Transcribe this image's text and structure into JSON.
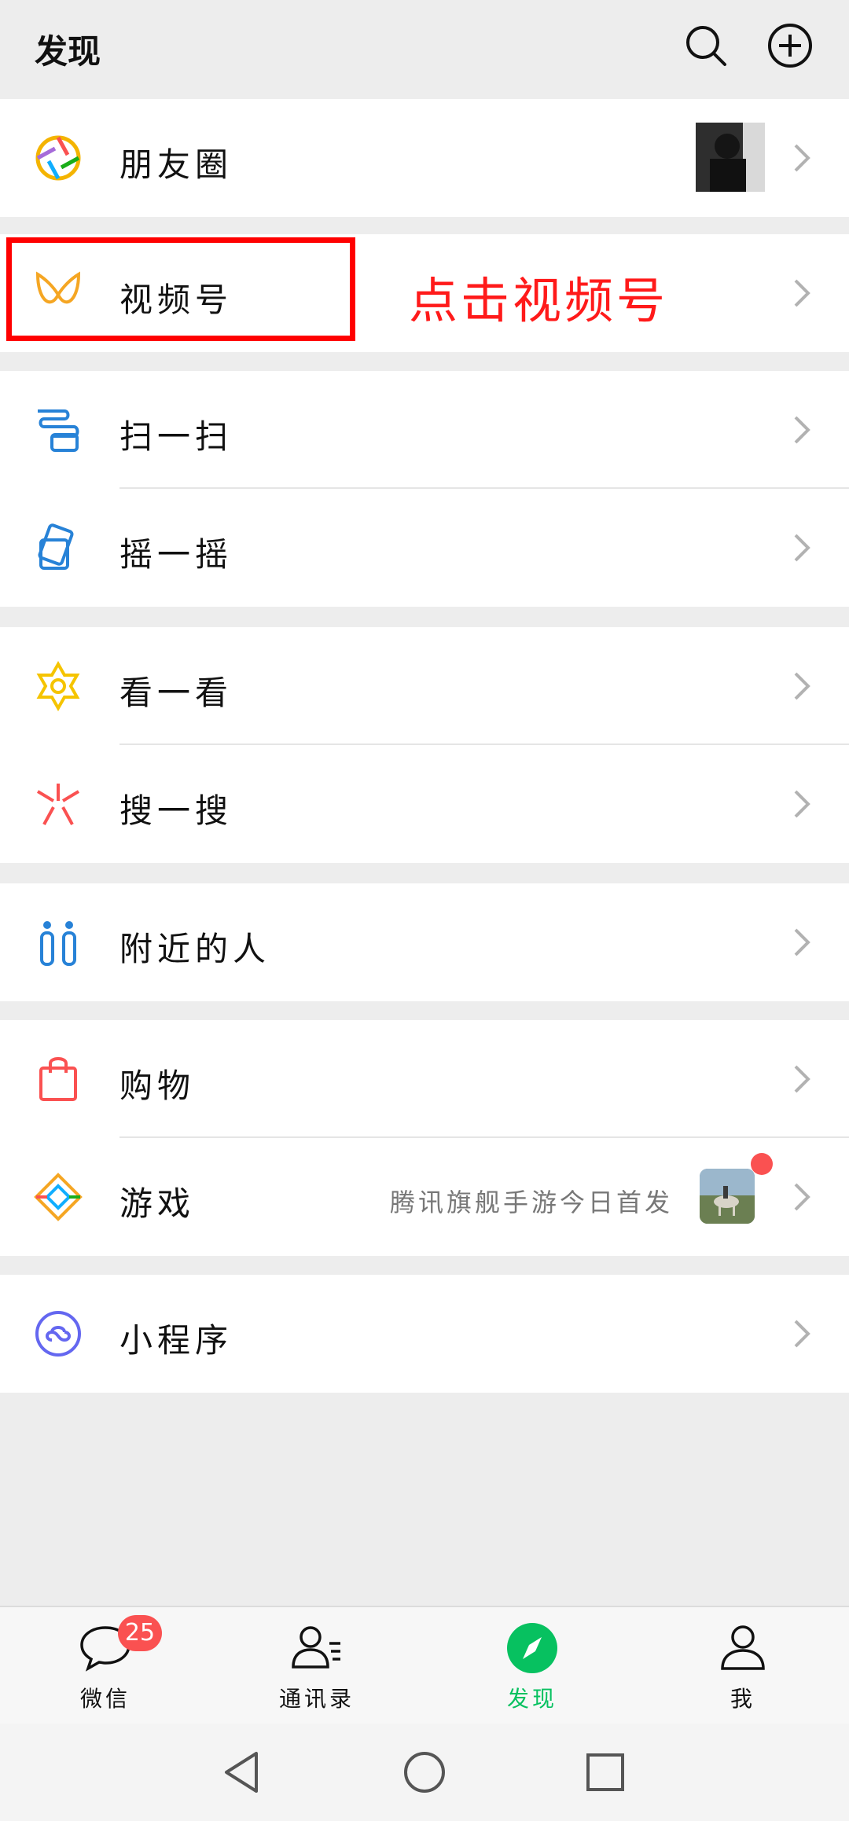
{
  "header": {
    "title": "发现"
  },
  "rows": {
    "moments": "朋友圈",
    "channels": "视频号",
    "scan": "扫一扫",
    "shake": "摇一摇",
    "top_stories": "看一看",
    "search": "搜一搜",
    "nearby": "附近的人",
    "shopping": "购物",
    "games": "游戏",
    "games_subtitle": "腾讯旗舰手游今日首发",
    "mini_programs": "小程序"
  },
  "annotation": {
    "text": "点击视频号"
  },
  "tabbar": {
    "chats": "微信",
    "chats_badge": "25",
    "contacts": "通讯录",
    "discover": "发现",
    "me": "我"
  },
  "colors": {
    "accent": "#07c160",
    "highlight": "#ff0000",
    "badge": "#fa5151"
  }
}
